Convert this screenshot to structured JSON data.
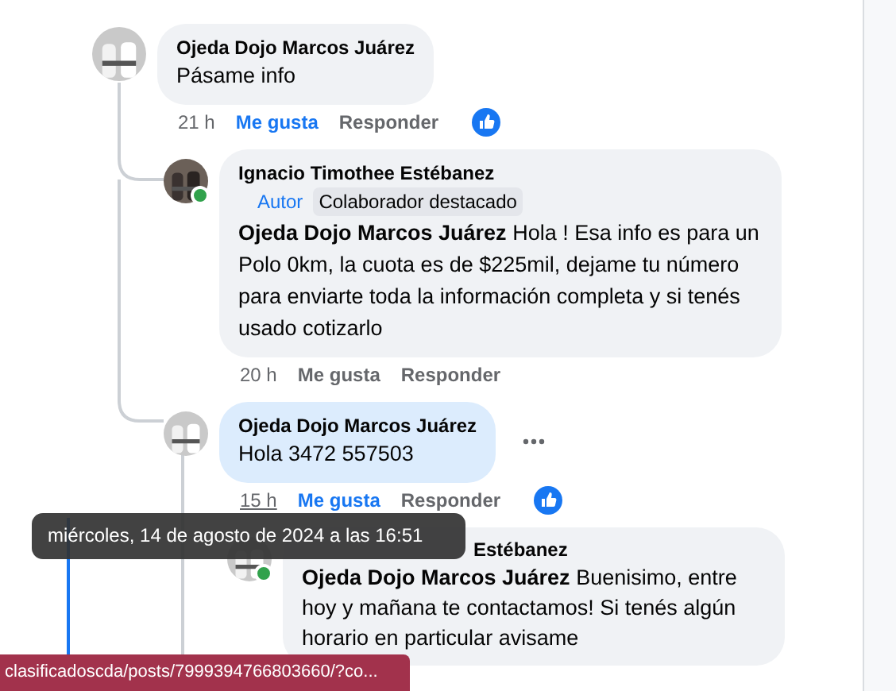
{
  "comments": [
    {
      "author": "Ojeda Dojo Marcos Juárez",
      "body": "Pásame info",
      "time": "21 h",
      "like_label": "Me gusta",
      "liked": true,
      "reply_label": "Responder",
      "reaction_shown": true,
      "children": [
        {
          "author": "Ignacio Timothee Estébanez",
          "online": true,
          "badges": [
            {
              "label": "Autor",
              "kind": "role"
            },
            {
              "label": "Colaborador destacado",
              "kind": "tag"
            }
          ],
          "body": "**Ojeda Dojo Marcos Juárez** Hola ! Esa info es para un Polo 0km, la cuota es de $225mil, dejame tu número para enviarte toda la información completa y si tenés usado cotizarlo",
          "time": "20 h",
          "like_label": "Me gusta",
          "liked": false,
          "reply_label": "Responder"
        },
        {
          "author": "Ojeda Dojo Marcos Juárez",
          "highlighted": true,
          "body": "Hola 3472 557503",
          "time": "15 h",
          "time_hovered": true,
          "like_label": "Me gusta",
          "liked": true,
          "reply_label": "Responder",
          "reaction_shown": true,
          "options_shown": true,
          "children": [
            {
              "author": "Estébanez",
              "author_partly_covered": true,
              "online": true,
              "body": "**Ojeda Dojo Marcos Juárez** Buenisimo, entre hoy y mañana te contactamos! Si tenés algún horario en particular avisame"
            }
          ]
        }
      ]
    }
  ],
  "tooltip": "miércoles, 14 de agosto de 2024 a las 16:51",
  "status_url": "clasificadoscda/posts/7999394766803660/?co..."
}
